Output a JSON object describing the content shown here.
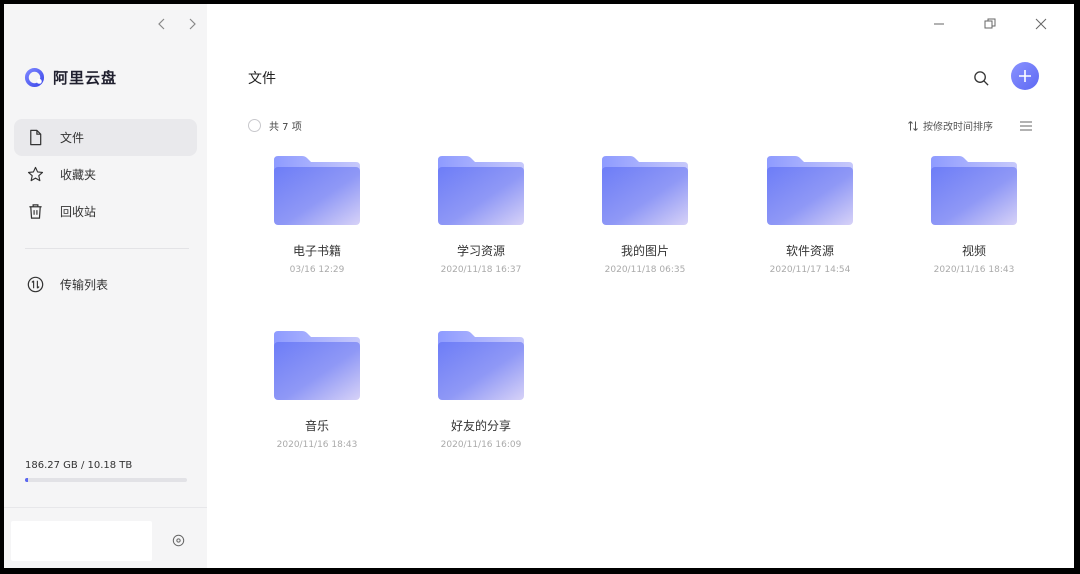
{
  "app": {
    "brand_name": "阿里云盘",
    "accent": "#5d68f3"
  },
  "sidebar": {
    "items": [
      {
        "label": "文件",
        "icon": "file-icon",
        "active": true
      },
      {
        "label": "收藏夹",
        "icon": "star-icon",
        "active": false
      },
      {
        "label": "回收站",
        "icon": "trash-icon",
        "active": false
      }
    ],
    "secondary_items": [
      {
        "label": "传输列表",
        "icon": "transfer-icon"
      }
    ],
    "storage": {
      "text": "186.27 GB / 10.18 TB",
      "used_fraction": 0.018
    }
  },
  "main": {
    "title": "文件",
    "count_label": "共 7 项",
    "sort_label": "按修改时间排序",
    "folders": [
      {
        "name": "电子书籍",
        "date": "03/16 12:29"
      },
      {
        "name": "学习资源",
        "date": "2020/11/18 16:37"
      },
      {
        "name": "我的图片",
        "date": "2020/11/18 06:35"
      },
      {
        "name": "软件资源",
        "date": "2020/11/17 14:54"
      },
      {
        "name": "视频",
        "date": "2020/11/16 18:43"
      },
      {
        "name": "音乐",
        "date": "2020/11/16 18:43"
      },
      {
        "name": "好友的分享",
        "date": "2020/11/16 16:09"
      }
    ]
  }
}
